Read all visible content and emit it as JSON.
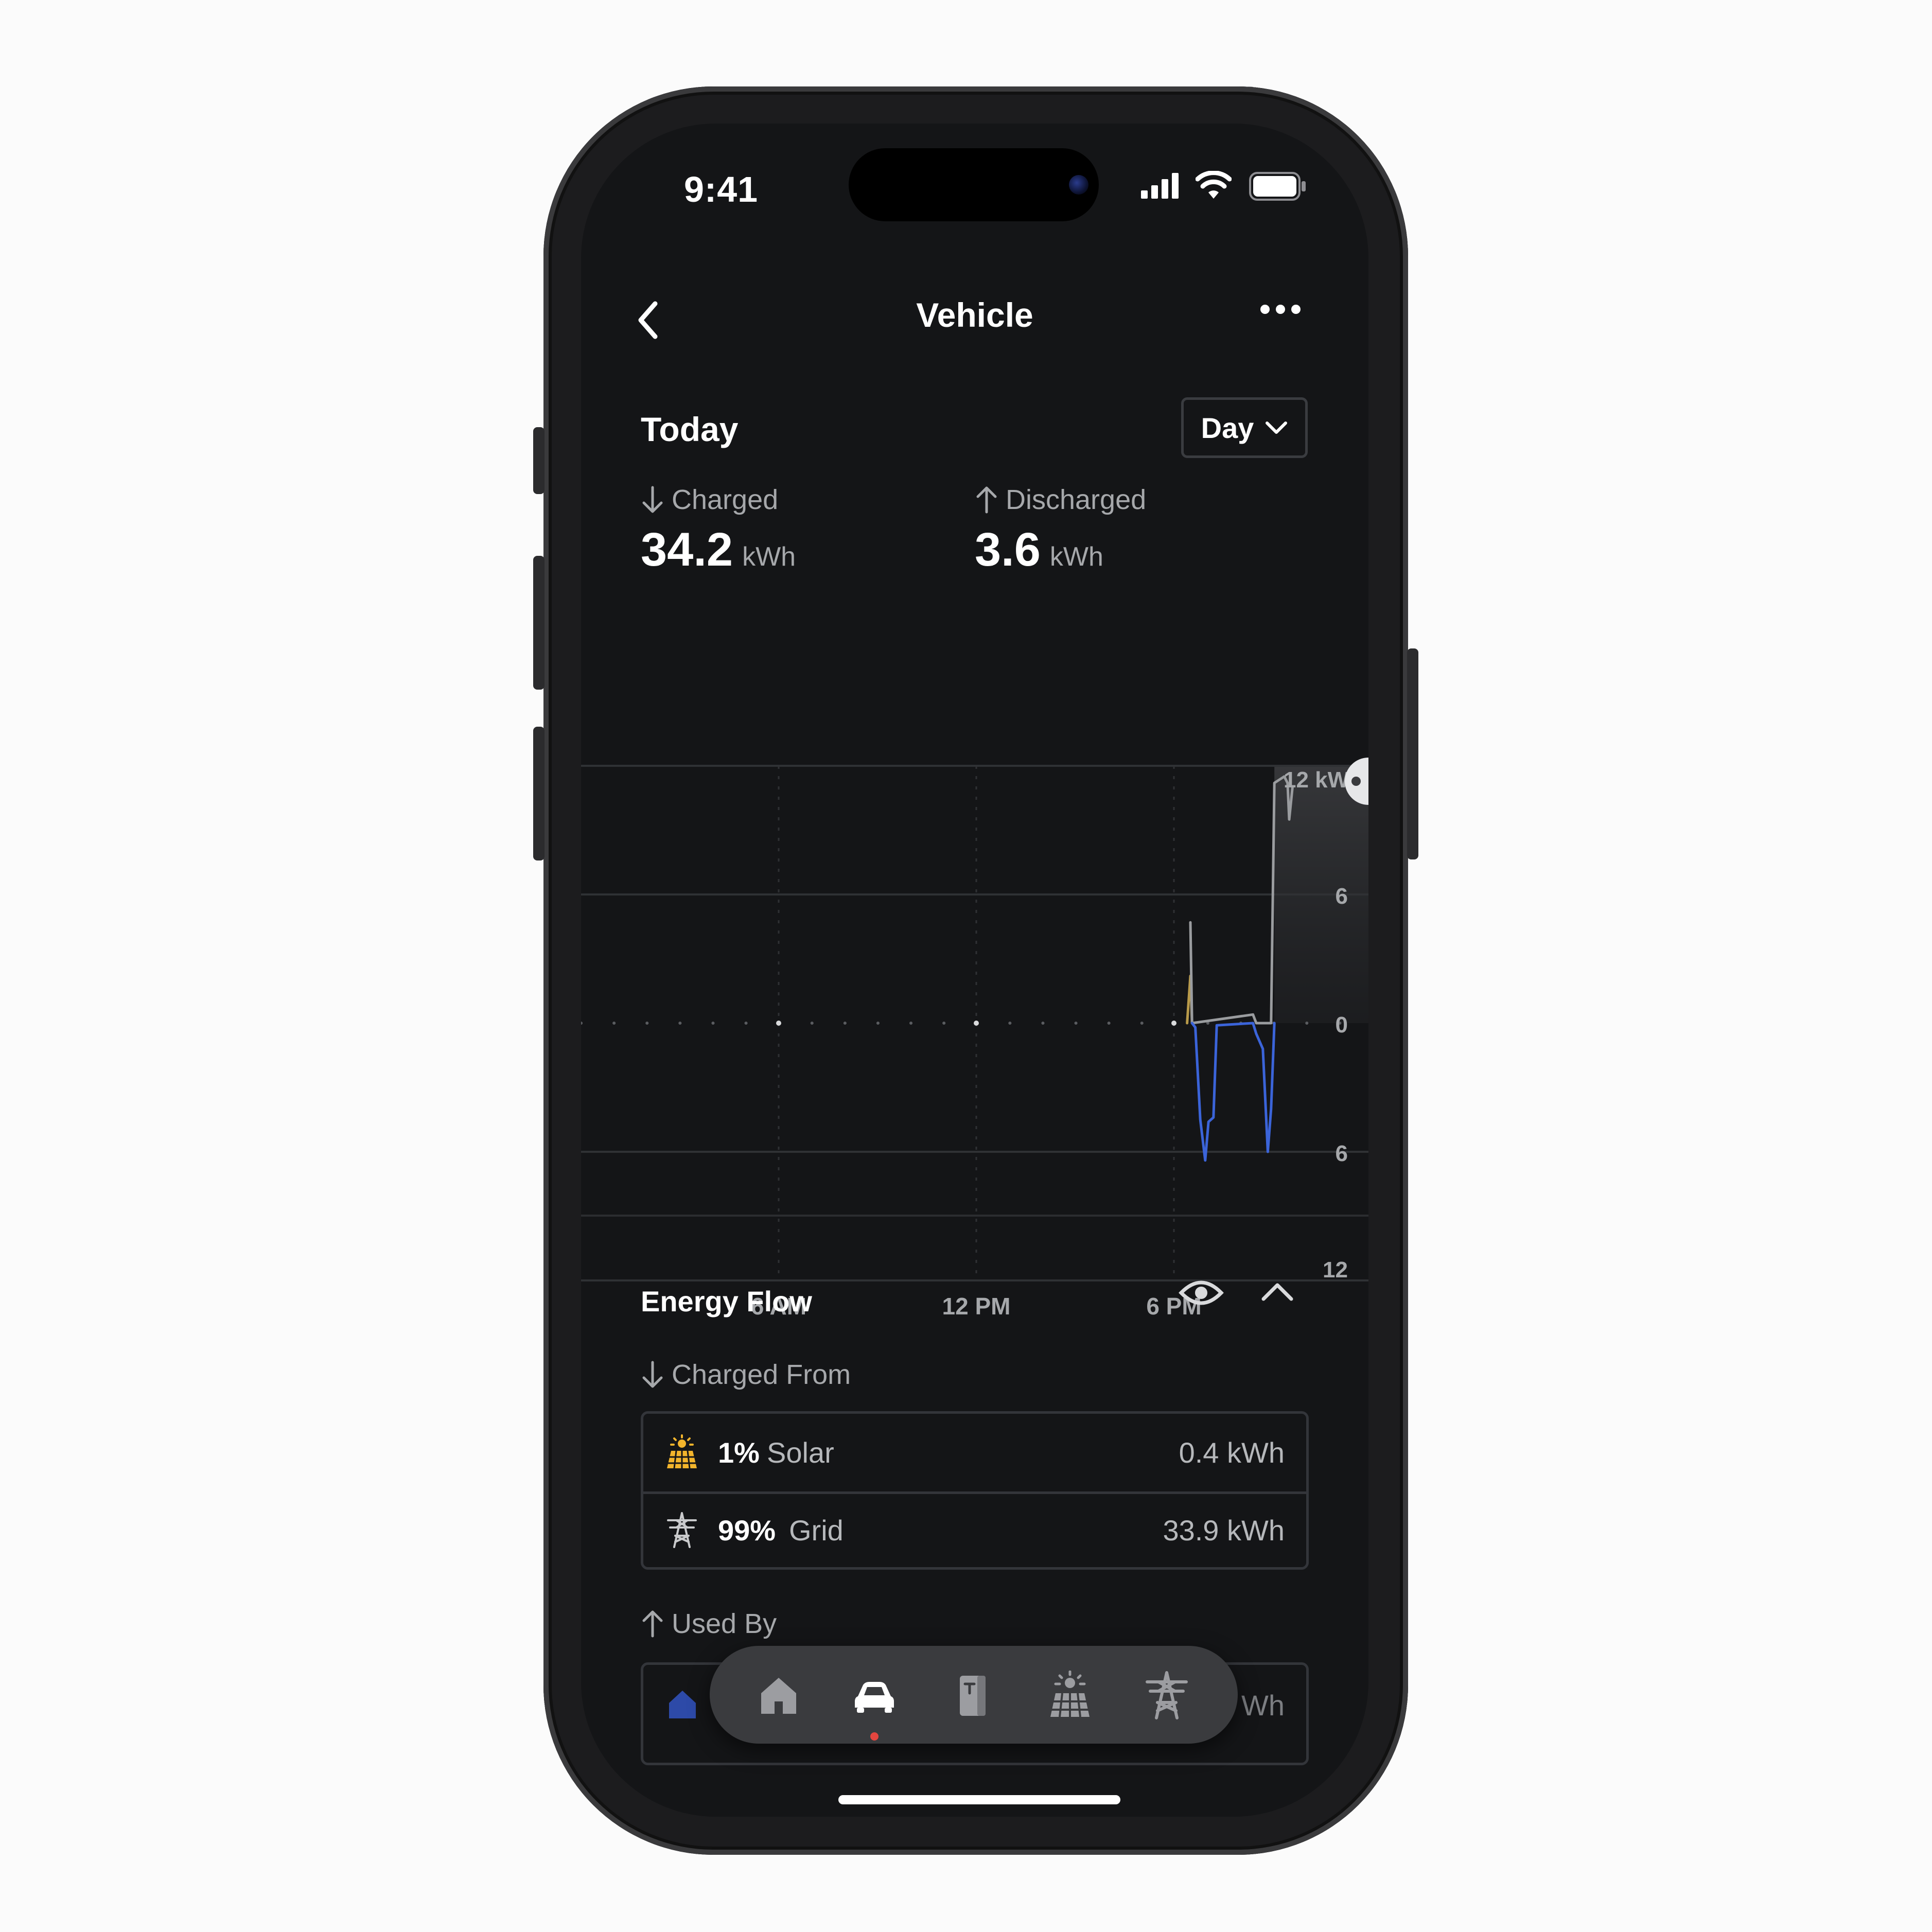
{
  "status_bar": {
    "time": "9:41"
  },
  "header": {
    "title": "Vehicle"
  },
  "period": {
    "heading": "Today",
    "selector_label": "Day"
  },
  "stats": {
    "charged": {
      "label": "Charged",
      "value": "34.2",
      "unit": "kWh"
    },
    "discharged": {
      "label": "Discharged",
      "value": "3.6",
      "unit": "kWh"
    }
  },
  "chart_data": {
    "type": "line",
    "x_unit": "hour of day",
    "xlim": [
      0,
      24
    ],
    "ylim": [
      -12,
      12
    ],
    "x_ticks": [
      {
        "x": 6,
        "label": "6 AM"
      },
      {
        "x": 12,
        "label": "12 PM"
      },
      {
        "x": 18,
        "label": "6 PM"
      }
    ],
    "y_ticks": [
      {
        "y": 12,
        "label": "12 kW"
      },
      {
        "y": 6,
        "label": "6"
      },
      {
        "y": 0,
        "label": "0"
      },
      {
        "y": -6,
        "label": "6"
      },
      {
        "y": -12,
        "label": "12"
      }
    ],
    "series": [
      {
        "color": "#b89a4a",
        "points": [
          [
            18.4,
            0
          ],
          [
            18.5,
            2.2
          ],
          [
            18.55,
            0
          ]
        ]
      },
      {
        "color": "#9a9c9f",
        "points": [
          [
            18.5,
            4.7
          ],
          [
            18.55,
            0
          ],
          [
            20.4,
            0.4
          ],
          [
            20.5,
            0
          ],
          [
            20.95,
            0
          ],
          [
            21.05,
            11.2
          ],
          [
            21.35,
            11.5
          ],
          [
            21.45,
            11.2
          ],
          [
            21.5,
            9.5
          ],
          [
            21.6,
            11.0
          ]
        ]
      },
      {
        "color": "#3b64d9",
        "points": [
          [
            18.55,
            0
          ],
          [
            18.65,
            -0.2
          ],
          [
            18.8,
            -4.5
          ],
          [
            18.95,
            -6.4
          ],
          [
            19.05,
            -4.6
          ],
          [
            19.2,
            -4.4
          ],
          [
            19.3,
            -0.1
          ],
          [
            20.4,
            0
          ],
          [
            20.5,
            -0.5
          ],
          [
            20.7,
            -1.2
          ],
          [
            20.85,
            -6.0
          ],
          [
            20.95,
            -4.0
          ],
          [
            21.05,
            0
          ]
        ]
      }
    ]
  },
  "energy_flow": {
    "title": "Energy Flow",
    "charged_from_label": "Charged From",
    "sources": [
      {
        "pct": "1%",
        "name": "Solar",
        "value": "0.4 kWh",
        "icon": "solar-panel-icon",
        "color": "#f2b42c"
      },
      {
        "pct": "99%",
        "name": "Grid",
        "value": "33.9 kWh",
        "icon": "power-tower-icon",
        "color": "#c9cacc"
      }
    ],
    "used_by_label": "Used By",
    "used_by_partial_value": "Wh"
  },
  "tab_bar": {
    "items": [
      {
        "icon": "home-icon"
      },
      {
        "icon": "car-icon"
      },
      {
        "icon": "powerwall-icon"
      },
      {
        "icon": "solar-panel-icon"
      },
      {
        "icon": "power-tower-icon"
      }
    ],
    "active_index": 1,
    "active_dot_color": "#e3463f"
  }
}
